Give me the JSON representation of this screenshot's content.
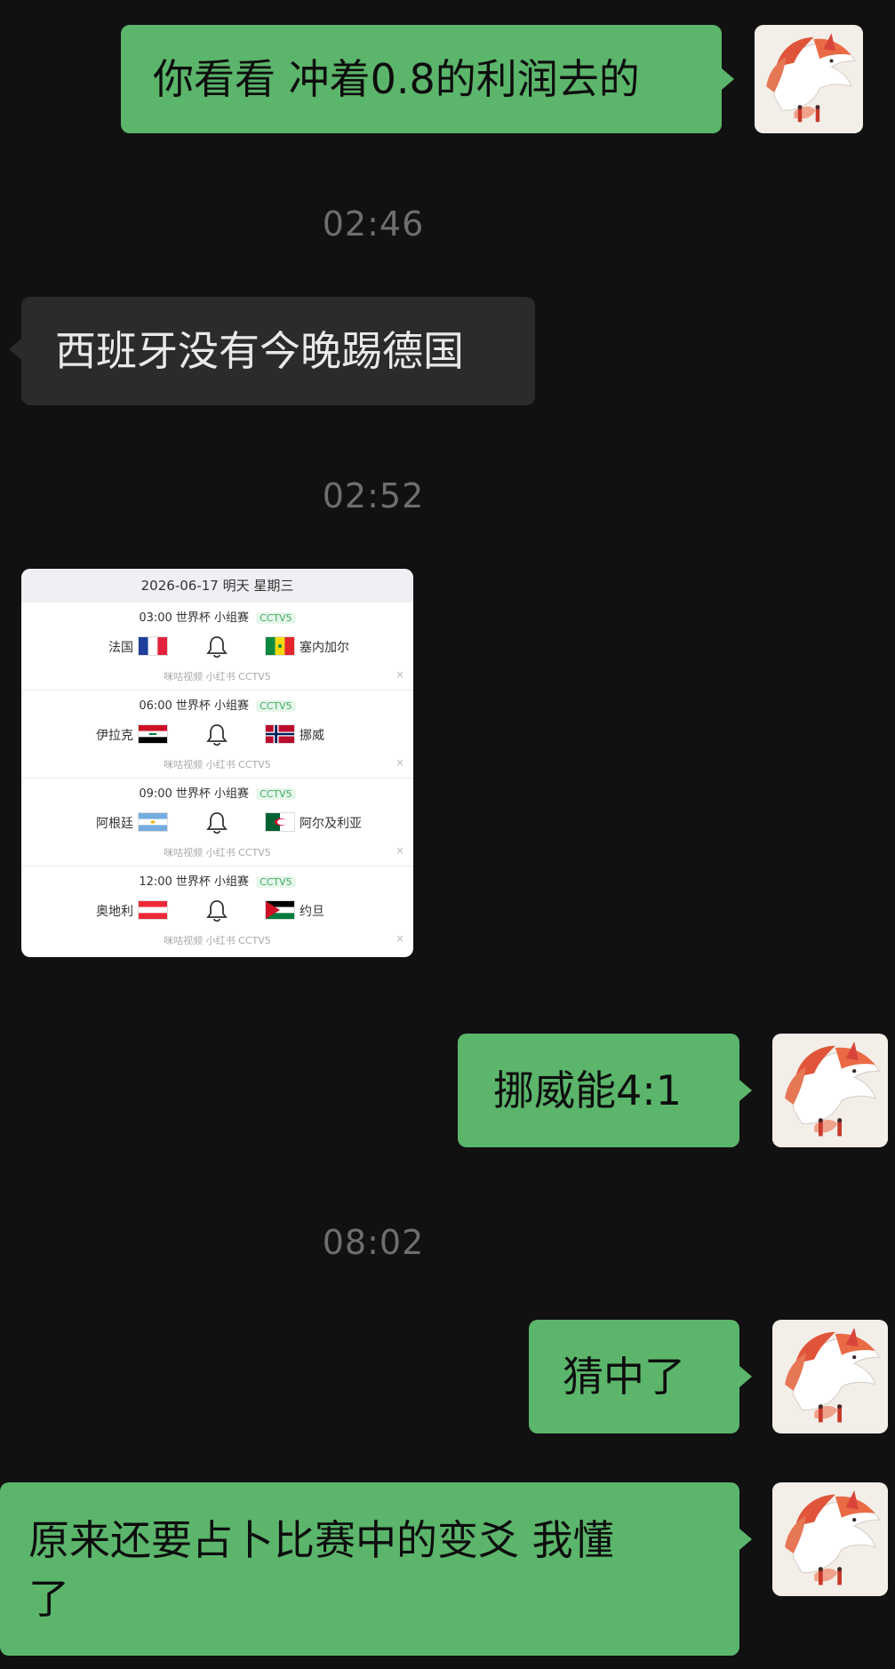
{
  "messages": [
    {
      "side": "out",
      "text": "你看看 冲着0.8的利润去的"
    },
    {
      "type": "timestamp",
      "text": "02:46"
    },
    {
      "side": "in",
      "text": "西班牙没有今晚踢德国"
    },
    {
      "type": "timestamp",
      "text": "02:52"
    },
    {
      "side": "in",
      "type": "image"
    },
    {
      "side": "out",
      "text": "挪威能4:1"
    },
    {
      "type": "timestamp",
      "text": "08:02"
    },
    {
      "side": "out",
      "text": "猜中了"
    },
    {
      "side": "out",
      "text": "原来还要占卜比赛中的变爻 我懂\n了"
    }
  ],
  "schedule": {
    "header": "2026-06-17 明天 星期三",
    "matches": [
      {
        "time_league": "03:00 世界杯 小组赛",
        "channel": "CCTV5",
        "home": "法国",
        "away": "塞内加尔",
        "source": "咪咕视频 小红书 CCTV5",
        "close": "×",
        "home_flag": "france",
        "away_flag": "senegal"
      },
      {
        "time_league": "06:00 世界杯 小组赛",
        "channel": "CCTV5",
        "home": "伊拉克",
        "away": "挪威",
        "source": "咪咕视频 小红书 CCTV5",
        "close": "×",
        "home_flag": "iraq",
        "away_flag": "norway"
      },
      {
        "time_league": "09:00 世界杯 小组赛",
        "channel": "CCTV5",
        "home": "阿根廷",
        "away": "阿尔及利亚",
        "source": "咪咕视频 小红书 CCTV5",
        "close": "×",
        "home_flag": "argentina",
        "away_flag": "algeria"
      },
      {
        "time_league": "12:00 世界杯 小组赛",
        "channel": "CCTV5",
        "home": "奥地利",
        "away": "约旦",
        "source": "咪咕视频 小红书 CCTV5",
        "close": "×",
        "home_flag": "austria",
        "away_flag": "jordan"
      }
    ]
  },
  "colors": {
    "background": "#111111",
    "outgoing_bubble": "#5bb56b",
    "incoming_bubble": "#2b2b2b",
    "timestamp": "#6e6e6e"
  },
  "icons": {
    "avatar": "fox-avatar-icon",
    "bell": "bell-icon"
  }
}
